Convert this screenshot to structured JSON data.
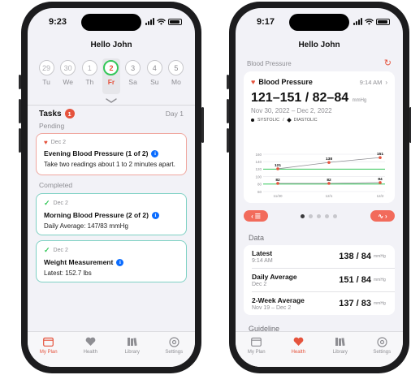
{
  "left": {
    "status_time": "9:23",
    "title": "Hello John",
    "days": [
      {
        "num": "29",
        "label": "Tu",
        "state": "past"
      },
      {
        "num": "30",
        "label": "We",
        "state": "past"
      },
      {
        "num": "1",
        "label": "Th",
        "state": "past"
      },
      {
        "num": "2",
        "label": "Fr",
        "state": "selected"
      },
      {
        "num": "3",
        "label": "Sa",
        "state": "future"
      },
      {
        "num": "4",
        "label": "Su",
        "state": "future"
      },
      {
        "num": "5",
        "label": "Mo",
        "state": "future"
      }
    ],
    "tasks_title": "Tasks",
    "tasks_badge": "1",
    "tasks_day": "Day 1",
    "pending_label": "Pending",
    "completed_label": "Completed",
    "pending_card": {
      "date": "Dec 2",
      "name": "Evening Blood Pressure (1 of 2)",
      "desc": "Take two readings about 1 to 2 minutes apart."
    },
    "done_cards": [
      {
        "date": "Dec 2",
        "name": "Morning Blood Pressure (2 of 2)",
        "desc": "Daily Average: 147/83 mmHg"
      },
      {
        "date": "Dec 2",
        "name": "Weight Measurement",
        "desc": "Latest: 152.7 lbs"
      }
    ],
    "tabs": [
      "My Plan",
      "Health",
      "Library",
      "Settings"
    ],
    "active_tab": "My Plan"
  },
  "right": {
    "status_time": "9:17",
    "title": "Hello John",
    "section_label": "Blood Pressure",
    "card": {
      "title": "Blood Pressure",
      "time": "9:14 AM",
      "value": "121–151 / 82–84",
      "unit": "mmHg",
      "range": "Nov 30, 2022 – Dec 2, 2022",
      "legend_systolic": "SYSTOLIC",
      "legend_diastolic": "DIASTOLIC"
    },
    "data_title": "Data",
    "rows": [
      {
        "label": "Latest",
        "sub": "9:14 AM",
        "value": "138 / 84",
        "unit": "mmHg"
      },
      {
        "label": "Daily Average",
        "sub": "Dec 2",
        "value": "151 / 84",
        "unit": "mmHg"
      },
      {
        "label": "2-Week Average",
        "sub": "Nov 19 – Dec 2",
        "value": "137 / 83",
        "unit": "mmHg"
      }
    ],
    "guideline_title": "Guideline",
    "tabs": [
      "My Plan",
      "Health",
      "Library",
      "Settings"
    ],
    "active_tab": "Health"
  },
  "colors": {
    "accent": "#e5533d",
    "green": "#34c759",
    "blue": "#0a6cff",
    "pending_border": "#f0a79f",
    "done_border": "#7fd1c4"
  },
  "chart_data": {
    "type": "line",
    "categories": [
      "11/30",
      "12/1",
      "12/2"
    ],
    "series": [
      {
        "name": "SYSTOLIC",
        "values": [
          121,
          138,
          151
        ]
      },
      {
        "name": "DIASTOLIC",
        "values": [
          82,
          82,
          84
        ]
      }
    ],
    "ylim": [
      60,
      160
    ],
    "yticks": [
      160,
      140,
      120,
      100,
      80,
      60
    ],
    "thresholds": [
      120,
      80
    ],
    "grid": true
  }
}
